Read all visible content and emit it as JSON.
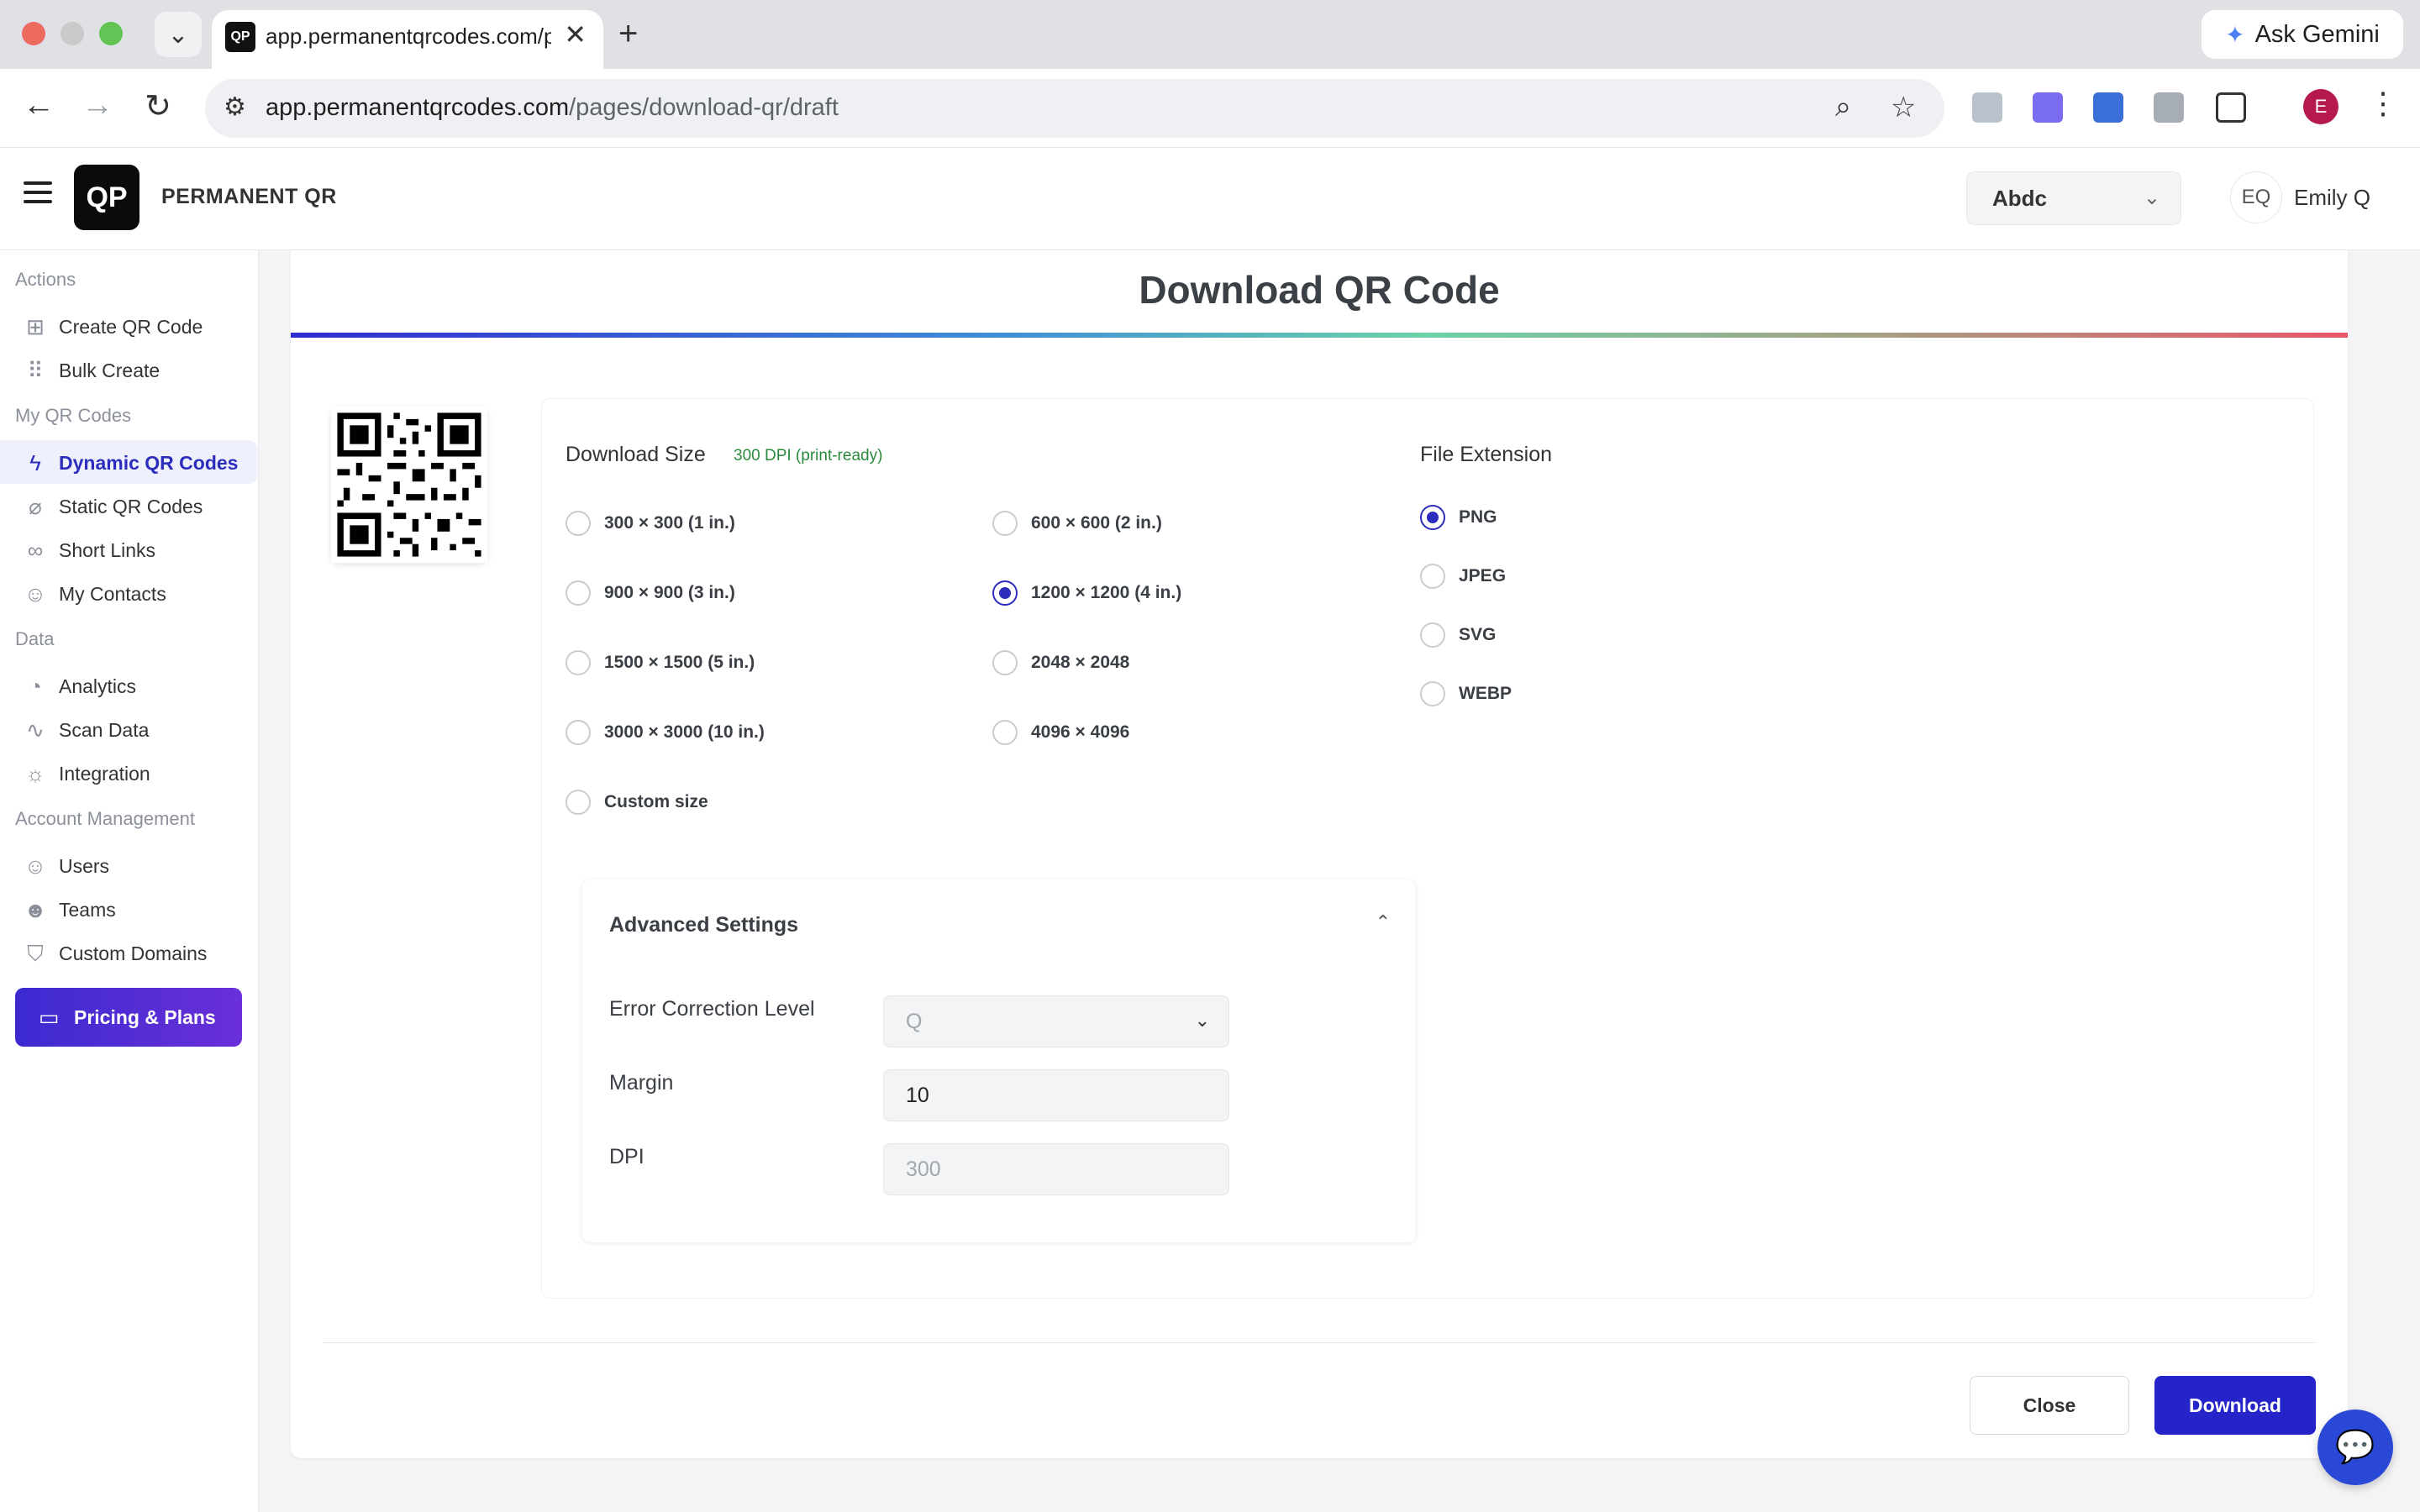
{
  "browser": {
    "tab_title": "app.permanentqrcodes.com/p",
    "tab_favicon_text": "QP",
    "new_tab_symbol": "+",
    "close_symbol": "✕",
    "gemini_label": "Ask Gemini",
    "url_host": "app.permanentqrcodes.com",
    "url_path": "/pages/download-qr/draft",
    "profile_initial": "E"
  },
  "header": {
    "brand": "PERMANENT QR",
    "logo_text": "QP",
    "workspace": "Abdc",
    "user_initials": "EQ",
    "user_name": "Emily Q"
  },
  "sidebar": {
    "sections": {
      "actions": "Actions",
      "my_codes": "My QR Codes",
      "data": "Data",
      "account": "Account Management"
    },
    "items": [
      {
        "label": "Create QR Code",
        "icon": "plus-square-icon"
      },
      {
        "label": "Bulk Create",
        "icon": "grid-icon"
      },
      {
        "label": "Dynamic QR Codes",
        "icon": "bolt-icon",
        "active": true
      },
      {
        "label": "Static QR Codes",
        "icon": "bolt-off-icon"
      },
      {
        "label": "Short Links",
        "icon": "link-icon"
      },
      {
        "label": "My Contacts",
        "icon": "users-icon"
      },
      {
        "label": "Analytics",
        "icon": "pie-chart-icon"
      },
      {
        "label": "Scan Data",
        "icon": "activity-icon"
      },
      {
        "label": "Integration",
        "icon": "plug-icon"
      },
      {
        "label": "Users",
        "icon": "user-plus-icon"
      },
      {
        "label": "Teams",
        "icon": "team-icon"
      },
      {
        "label": "Custom Domains",
        "icon": "shield-icon"
      }
    ],
    "pricing_label": "Pricing & Plans"
  },
  "main": {
    "title": "Download QR Code",
    "download_size_title": "Download Size",
    "download_size_sub": "300 DPI (print-ready)",
    "sizes": [
      {
        "label": "300 × 300 (1 in.)",
        "checked": false
      },
      {
        "label": "600 × 600 (2 in.)",
        "checked": false
      },
      {
        "label": "900 × 900 (3 in.)",
        "checked": false
      },
      {
        "label": "1200 × 1200 (4 in.)",
        "checked": true
      },
      {
        "label": "1500 × 1500 (5 in.)",
        "checked": false
      },
      {
        "label": "2048 × 2048",
        "checked": false
      },
      {
        "label": "3000 × 3000 (10 in.)",
        "checked": false
      },
      {
        "label": "4096 × 4096",
        "checked": false
      },
      {
        "label": "Custom size",
        "checked": false
      }
    ],
    "file_ext_title": "File Extension",
    "extensions": [
      {
        "label": "PNG",
        "checked": true
      },
      {
        "label": "JPEG",
        "checked": false
      },
      {
        "label": "SVG",
        "checked": false
      },
      {
        "label": "WEBP",
        "checked": false
      }
    ],
    "advanced": {
      "title": "Advanced Settings",
      "ecl_label": "Error Correction Level",
      "ecl_value": "Q",
      "margin_label": "Margin",
      "margin_value": "10",
      "dpi_label": "DPI",
      "dpi_placeholder": "300"
    },
    "close_label": "Close",
    "download_label": "Download"
  },
  "colors": {
    "accent": "#2c2dbd",
    "primary_button": "#2424c8",
    "success_text": "#2a8a3c"
  }
}
